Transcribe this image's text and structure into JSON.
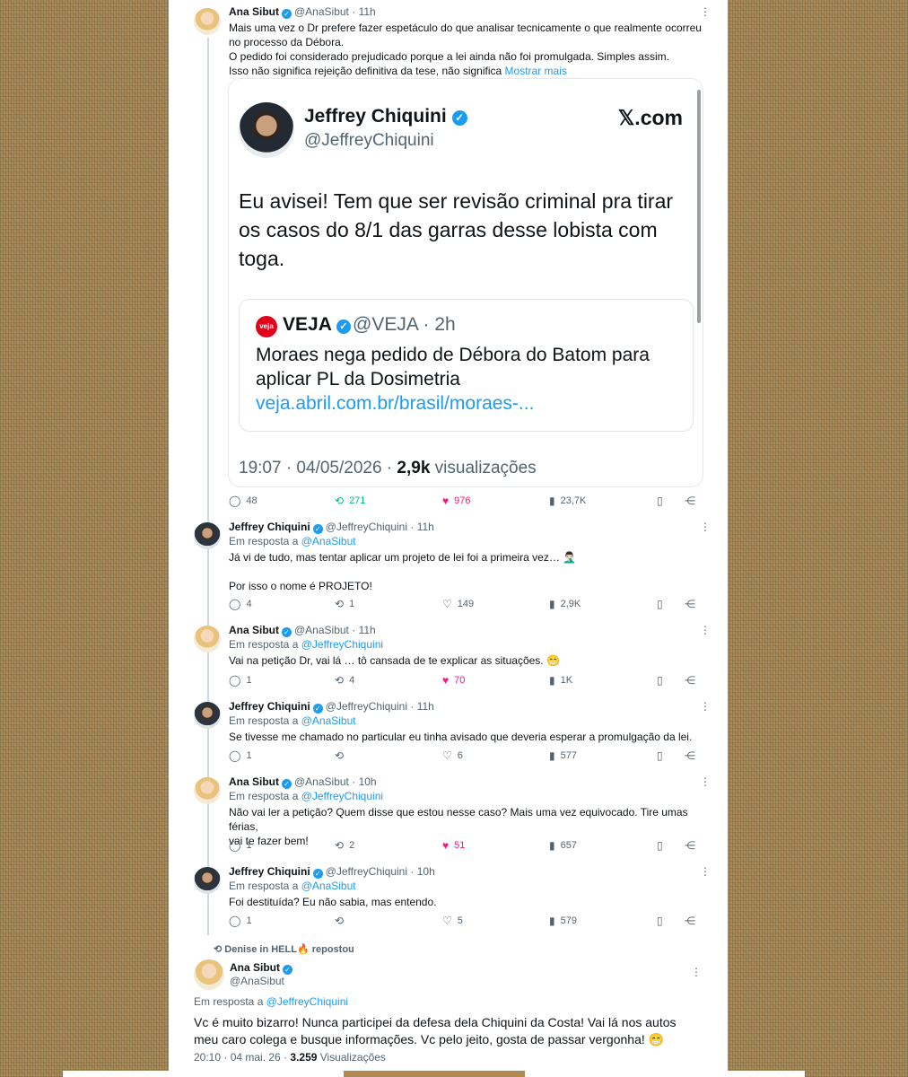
{
  "tweet1": {
    "name": "Ana Sibut",
    "handle": "@AnaSibut",
    "time": "11h",
    "text_lines": [
      "Mais uma vez o Dr prefere fazer espetáculo do que analisar tecnicamente o que realmente ocorreu",
      "no processo da Débora.",
      "O pedido foi considerado prejudicado porque a lei ainda não foi promulgada. Simples assim.",
      "Isso não significa rejeição definitiva da tese, não significa"
    ],
    "show_more": "Mostrar mais",
    "quote": {
      "name": "Jeffrey Chiquini",
      "handle": "@JeffreyChiquini",
      "site": "𝕏.com",
      "text": "Eu avisei! Tem que ser revisão criminal pra tirar os casos do 8/1 das garras desse lobista com toga.",
      "inner": {
        "logo": "veja",
        "name": "VEJA",
        "meta": "@VEJA · 2h",
        "text": "Moraes nega pedido de Débora do Batom para aplicar PL da Dosimetria",
        "link": "veja.abril.com.br/brasil/moraes-..."
      },
      "datetime": "19:07 · 04/05/2026 · ",
      "views": "2,9k",
      "views_label": " visualizações"
    },
    "stats": {
      "replies": "48",
      "reposts": "271",
      "likes": "976",
      "views": "23,7K"
    }
  },
  "replies": [
    {
      "name": "Jeffrey Chiquini",
      "handle": "@JeffreyChiquini",
      "time": "11h",
      "reply_to": "@AnaSibut",
      "lines": [
        "Já vi de tudo, mas tentar aplicar um projeto de lei foi a primeira vez… 🤦🏻‍♂️",
        "",
        "Por isso o nome é PROJETO!"
      ],
      "stats": {
        "replies": "4",
        "reposts": "1",
        "likes": "149",
        "views": "2,9K"
      }
    },
    {
      "name": "Ana Sibut",
      "handle": "@AnaSibut",
      "time": "11h",
      "reply_to": "@JeffreyChiquini",
      "lines": [
        "Vai na petição Dr, vai lá … tô cansada de te explicar as situações. 😁"
      ],
      "stats": {
        "replies": "1",
        "reposts": "4",
        "likes": "70",
        "views": "1K"
      }
    },
    {
      "name": "Jeffrey Chiquini",
      "handle": "@JeffreyChiquini",
      "time": "11h",
      "reply_to": "@AnaSibut",
      "lines": [
        "Se tivesse me chamado no particular eu tinha avisado que deveria esperar a promulgação da lei."
      ],
      "stats": {
        "replies": "1",
        "reposts": "",
        "likes": "6",
        "views": "577"
      }
    },
    {
      "name": "Ana Sibut",
      "handle": "@AnaSibut",
      "time": "10h",
      "reply_to": "@JeffreyChiquini",
      "lines": [
        "Não vai ler a petição? Quem disse que estou nesse caso? Mais uma vez equivocado. Tire umas férias,",
        "vai te fazer bem!"
      ],
      "stats": {
        "replies": "1",
        "reposts": "2",
        "likes": "51",
        "views": "657"
      }
    },
    {
      "name": "Jeffrey Chiquini",
      "handle": "@JeffreyChiquini",
      "time": "10h",
      "reply_to": "@AnaSibut",
      "lines": [
        "Foi destituída? Eu não sabia, mas entendo."
      ],
      "stats": {
        "replies": "1",
        "reposts": "",
        "likes": "5",
        "views": "579"
      }
    }
  ],
  "reply_prefix": "Em resposta a ",
  "repost_label": "Denise in HELL🔥 repostou",
  "final": {
    "name": "Ana Sibut",
    "handle": "@AnaSibut",
    "reply_to": "@JeffreyChiquini",
    "text": "Vc é muito bizarro! Nunca participei da defesa dela Chiquini da Costa! Vai lá nos autos meu caro colega e busque informações. Vc pelo jeito, gosta de passar vergonha! 😁",
    "datetime": "20:10 · 04 mai. 26 · ",
    "views": "3.259",
    "views_label": " Visualizações"
  },
  "icons": {
    "reply": "reply-icon",
    "repost": "repost-icon",
    "like": "heart-icon",
    "views": "views-icon",
    "bookmark": "bookmark-icon",
    "share": "share-icon"
  },
  "colors": {
    "accent": "#1d9bf0",
    "like": "#f91880",
    "repost": "#00ba7c"
  }
}
